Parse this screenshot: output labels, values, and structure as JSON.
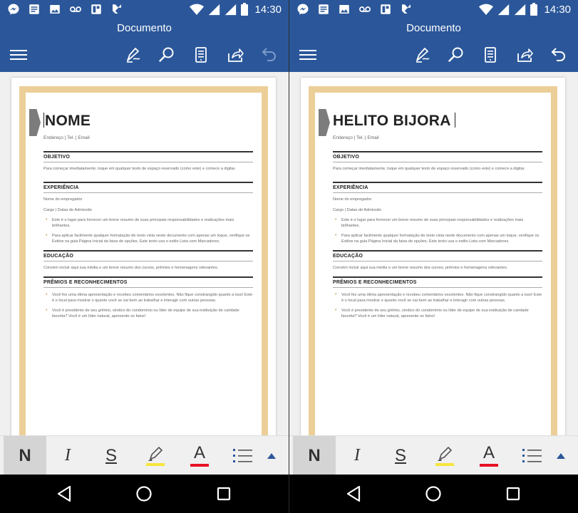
{
  "status_bar": {
    "time": "14:30",
    "icons": [
      "messenger-icon",
      "notes-icon",
      "gallery-icon",
      "voicemail-icon",
      "news-icon",
      "flipboard-icon",
      "wifi-icon",
      "signal-icon",
      "signal-icon",
      "battery-icon"
    ]
  },
  "app_bar": {
    "title": "Documento",
    "icons": [
      "menu-icon",
      "pen-icon",
      "search-icon",
      "reading-view-icon",
      "share-icon",
      "undo-icon"
    ]
  },
  "document": {
    "section_titles": {
      "objective": "OBJETIVO",
      "experience": "EXPERIÊNCIA",
      "education": "EDUCAÇÃO",
      "awards": "PRÊMIOS E RECONHECIMENTOS"
    },
    "contact_line": "Endereço | Tel. | Email",
    "objective_text": "Para começar imediatamente, toque em qualquer texto de espaço reservado (como este) e comece a digitar.",
    "employer": "Nome do empregador",
    "role_dates": "Cargo | Datas de Admissão",
    "experience_bullets": [
      "Este é o lugar para fornecer um breve resumo de suas principais responsabilidades e realizações mais brilhantes.",
      "Para aplicar facilmente qualquer formatação de texto vista neste documento com apenas um toque, verifique os Estilos na guia Página Inicial da faixa de opções. Este texto usa o estilo Lista com Marcadores."
    ],
    "education_text": "Convém incluir aqui sua média e um breve resumo dos cursos, prêmios e homenagens relevantes.",
    "awards_bullets": [
      "Você fez uma ótima apresentação e recebeu comentários excelentes. Não fique constrangido quanto a isso! Este é o local para mostrar o quanto você se sai bem ao trabalhar e interagir com outras pessoas.",
      "Você é presidente de seu grêmio, síndico do condomínio ou líder de equipe de sua instituição de caridade favorita? Você é um líder natural, apresente os fatos!"
    ]
  },
  "screens": [
    {
      "name_text": "NOME"
    },
    {
      "name_text": "HELITO BIJORA"
    }
  ],
  "format_toolbar": {
    "bold_label": "N",
    "italic_label": "I",
    "strike_label": "S",
    "font_color_label": "A",
    "font_color": "#e81123",
    "highlight_color": "#f7e43c"
  },
  "colors": {
    "word_blue": "#2b579a",
    "frame_tan": "#eccf98",
    "accent_tab": "#7c7c7c"
  }
}
